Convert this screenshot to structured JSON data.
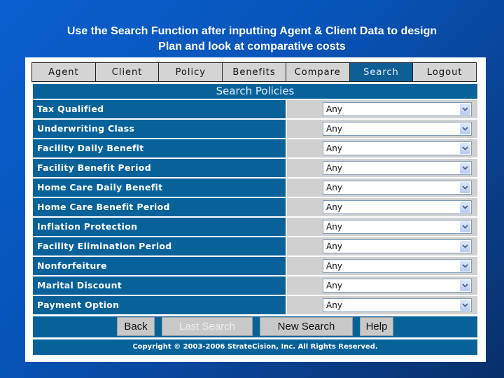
{
  "slide": {
    "title_line1": "Use the Search Function after inputting Agent & Client Data to design",
    "title_line2": "Plan and look at comparative costs"
  },
  "nav": {
    "tabs": [
      {
        "label": "Agent",
        "active": false
      },
      {
        "label": "Client",
        "active": false
      },
      {
        "label": "Policy",
        "active": false
      },
      {
        "label": "Benefits",
        "active": false
      },
      {
        "label": "Compare",
        "active": false
      },
      {
        "label": "Search",
        "active": true
      },
      {
        "label": "Logout",
        "active": false
      }
    ]
  },
  "section": {
    "title": "Search Policies"
  },
  "criteria": [
    {
      "label": "Tax Qualified",
      "value": "Any"
    },
    {
      "label": "Underwriting Class",
      "value": "Any"
    },
    {
      "label": "Facility Daily Benefit",
      "value": "Any"
    },
    {
      "label": "Facility Benefit Period",
      "value": "Any"
    },
    {
      "label": "Home Care Daily Benefit",
      "value": "Any"
    },
    {
      "label": "Home Care Benefit Period",
      "value": "Any"
    },
    {
      "label": "Inflation Protection",
      "value": "Any"
    },
    {
      "label": "Facility Elimination Period",
      "value": "Any"
    },
    {
      "label": "Nonforfeiture",
      "value": "Any"
    },
    {
      "label": "Marital Discount",
      "value": "Any"
    },
    {
      "label": "Payment Option",
      "value": "Any"
    }
  ],
  "buttons": {
    "back": "Back",
    "last_search": "Last Search",
    "new_search": "New Search",
    "help": "Help"
  },
  "footer": {
    "copyright": "Copyright © 2003-2006 StrateCision, Inc. All Rights Reserved."
  },
  "colors": {
    "primary": "#07629a",
    "tab_bg": "#d4d4d4",
    "cell_bg": "#d0d0d0"
  }
}
